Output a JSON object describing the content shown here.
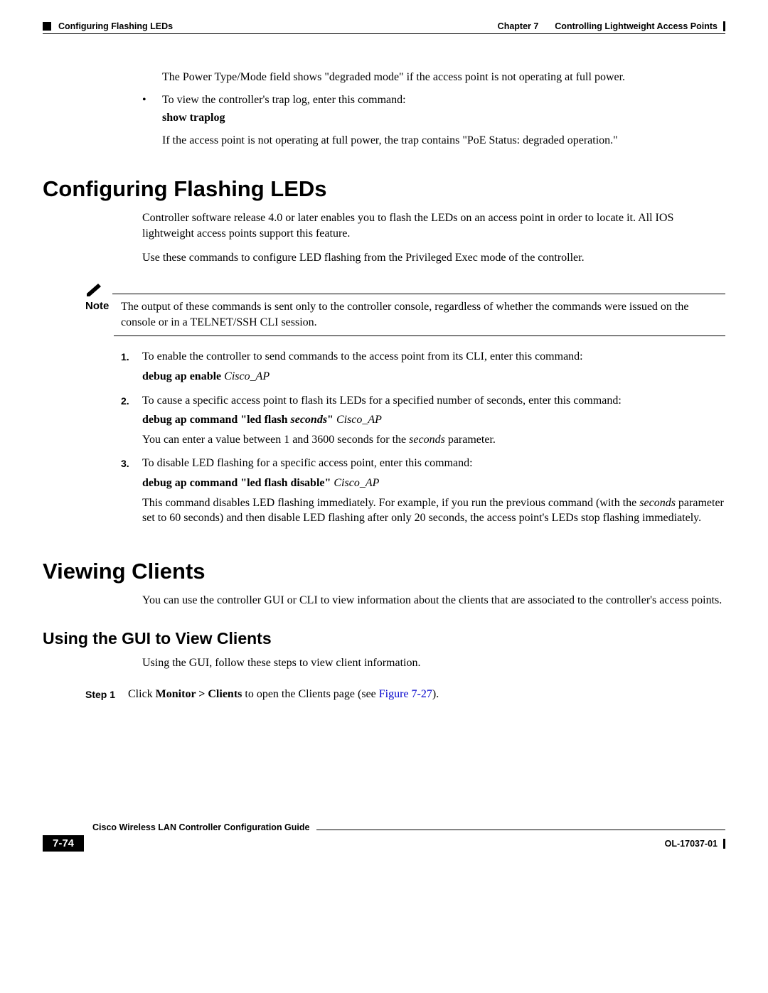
{
  "header": {
    "section": "Configuring Flashing LEDs",
    "chapter": "Chapter 7",
    "chapter_title": "Controlling Lightweight Access Points"
  },
  "intro": {
    "p1": "The Power Type/Mode field shows \"degraded mode\" if the access point is not operating at full power.",
    "bullet1": "To view the controller's trap log, enter this command:",
    "cmd1": "show traplog",
    "p2": "If the access point is not operating at full power, the trap contains \"PoE Status: degraded operation.\""
  },
  "sec1": {
    "title": "Configuring Flashing LEDs",
    "p1": "Controller software release 4.0 or later enables you to flash the LEDs on an access point in order to locate it. All IOS lightweight access points support this feature.",
    "p2": "Use these commands to configure LED flashing from the Privileged Exec mode of the controller.",
    "note_label": "Note",
    "note_text": "The output of these commands is sent only to the controller console, regardless of whether the commands were issued on the console or in a TELNET/SSH CLI session.",
    "step1_num": "1.",
    "step1_text": "To enable the controller to send commands to the access point from its CLI, enter this command:",
    "step1_cmd_bold": "debug ap enable ",
    "step1_cmd_ital": "Cisco_AP",
    "step2_num": "2.",
    "step2_text": "To cause a specific access point to flash its LEDs for a specified number of seconds, enter this command:",
    "step2_cmd_b1": "debug ap command \"led flash ",
    "step2_cmd_i": "seconds",
    "step2_cmd_b2": "\" ",
    "step2_cmd_i2": "Cisco_AP",
    "step2_p2a": "You can enter a value between 1 and 3600 seconds for the ",
    "step2_p2i": "seconds",
    "step2_p2b": " parameter.",
    "step3_num": "3.",
    "step3_text": "To disable LED flashing for a specific access point, enter this command:",
    "step3_cmd_b": "debug ap command \"led flash disable\" ",
    "step3_cmd_i": "Cisco_AP",
    "step3_p2a": "This command disables LED flashing immediately. For example, if you run the previous command (with the ",
    "step3_p2i": "seconds",
    "step3_p2b": " parameter set to 60 seconds) and then disable LED flashing after only 20 seconds, the access point's LEDs stop flashing immediately."
  },
  "sec2": {
    "title": "Viewing Clients",
    "p1": "You can use the controller GUI or CLI to view information about the clients that are associated to the controller's access points.",
    "sub_title": "Using the GUI to View Clients",
    "sub_p1": "Using the GUI, follow these steps to view client information.",
    "step_label": "Step 1",
    "step_text1": "Click ",
    "step_bold": "Monitor > Clients",
    "step_text2": " to open the Clients page (see ",
    "step_link": "Figure 7-27",
    "step_text3": ")."
  },
  "footer": {
    "guide": "Cisco Wireless LAN Controller Configuration Guide",
    "page": "7-74",
    "docid": "OL-17037-01"
  }
}
